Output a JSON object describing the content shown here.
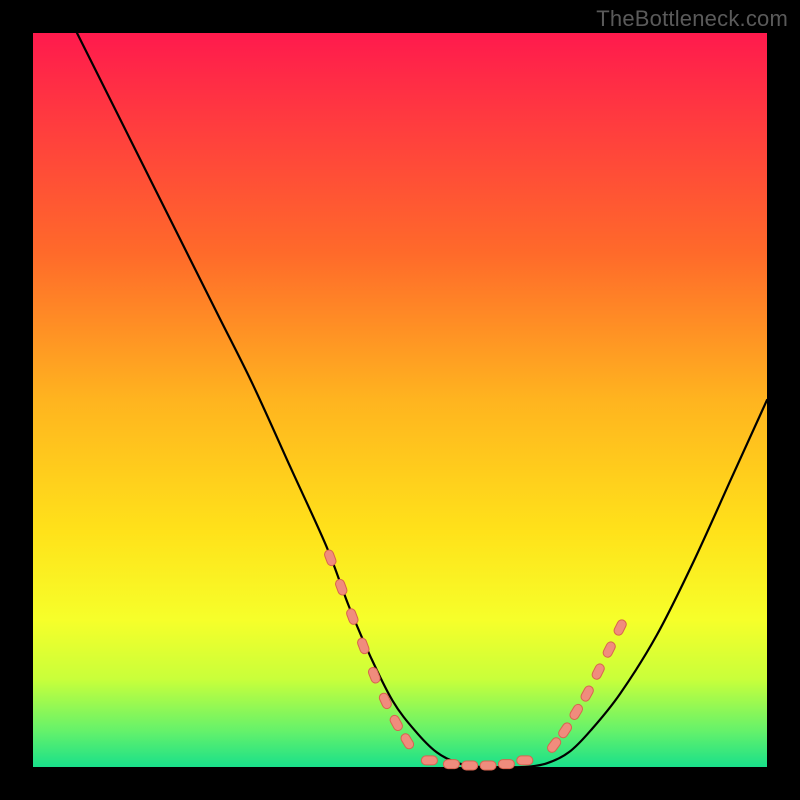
{
  "watermark": "TheBottleneck.com",
  "colors": {
    "background": "#000000",
    "gradient_top": "#ff1a4d",
    "gradient_mid": "#ffe21a",
    "gradient_bottom": "#19e08a",
    "curve": "#000000",
    "marker_fill": "#f08c7d",
    "marker_stroke": "#d9634f"
  },
  "chart_data": {
    "type": "line",
    "title": "",
    "xlabel": "",
    "ylabel": "",
    "xlim": [
      0,
      100
    ],
    "ylim": [
      0,
      100
    ],
    "x": [
      6,
      10,
      15,
      20,
      25,
      30,
      35,
      40,
      43,
      46,
      49,
      52,
      55,
      58,
      61,
      64,
      67,
      70,
      73,
      76,
      80,
      85,
      90,
      95,
      100
    ],
    "values": [
      100,
      92,
      82,
      72,
      62,
      52,
      41,
      30,
      22,
      15,
      9,
      5,
      2,
      0.5,
      0,
      0,
      0,
      0.5,
      2,
      5,
      10,
      18,
      28,
      39,
      50
    ],
    "curve_notes": "V-shaped bottleneck curve; minimum (≈0) around x 58–67; left branch starts near 100 at x≈6; right branch rises to ≈50 by x=100.",
    "series": [
      {
        "name": "markers-left",
        "x": [
          40.5,
          42.0,
          43.5,
          45.0,
          46.5,
          48.0,
          49.5,
          51.0
        ],
        "values": [
          28.5,
          24.5,
          20.5,
          16.5,
          12.5,
          9.0,
          6.0,
          3.5
        ]
      },
      {
        "name": "markers-bottom",
        "x": [
          54.0,
          57.0,
          59.5,
          62.0,
          64.5,
          67.0
        ],
        "values": [
          0.9,
          0.4,
          0.2,
          0.2,
          0.4,
          0.9
        ]
      },
      {
        "name": "markers-right",
        "x": [
          71.0,
          72.5,
          74.0,
          75.5,
          77.0,
          78.5,
          80.0
        ],
        "values": [
          3.0,
          5.0,
          7.5,
          10.0,
          13.0,
          16.0,
          19.0
        ]
      }
    ]
  }
}
